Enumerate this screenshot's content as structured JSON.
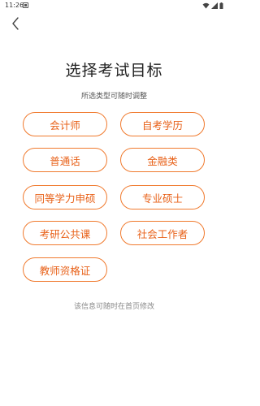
{
  "status_bar": {
    "time": "11:26"
  },
  "header": {
    "title": "选择考试目标",
    "subtitle": "所选类型可随时调整"
  },
  "options": [
    {
      "label": "会计师"
    },
    {
      "label": "自考学历"
    },
    {
      "label": "普通话"
    },
    {
      "label": "金融类"
    },
    {
      "label": "同等学力申硕"
    },
    {
      "label": "专业硕士"
    },
    {
      "label": "考研公共课"
    },
    {
      "label": "社会工作者"
    },
    {
      "label": "教师资格证"
    }
  ],
  "footer": {
    "note": "该信息可随时在首页修改"
  },
  "colors": {
    "accent": "#e8621a",
    "accent_border": "#f07a2e"
  }
}
